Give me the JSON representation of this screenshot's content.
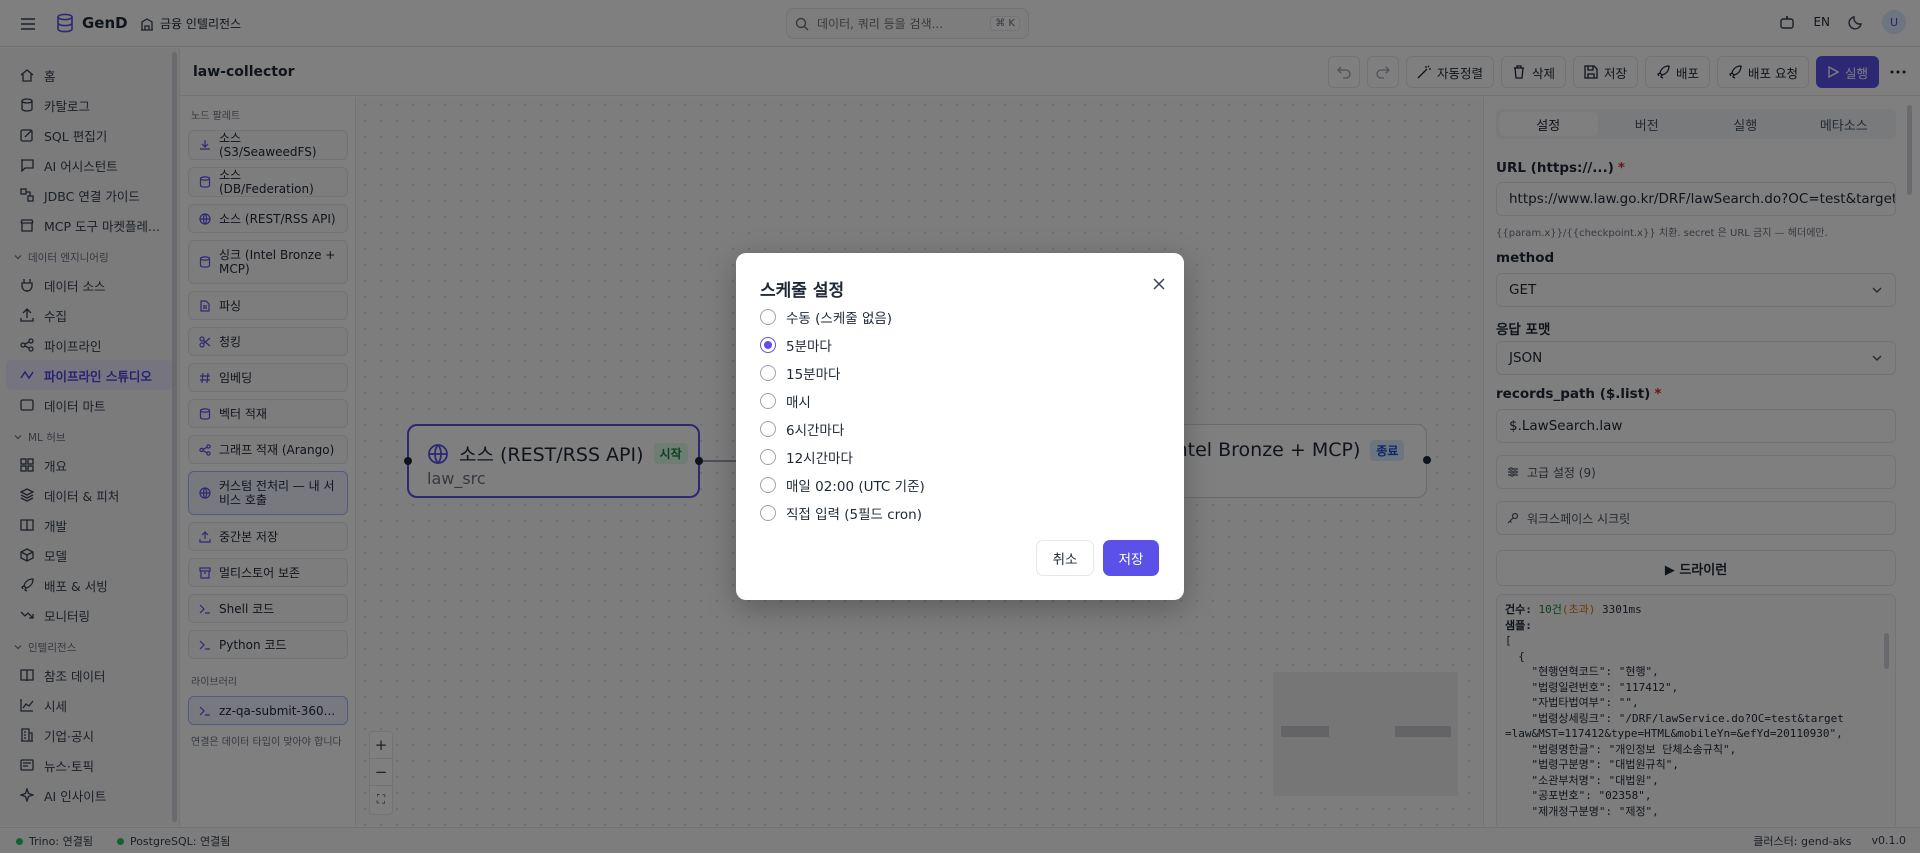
{
  "app": {
    "name": "GenD",
    "workspace": "금융 인텔리전스"
  },
  "search": {
    "placeholder": "데이터, 쿼리 등을 검색...",
    "shortcut": "⌘ K"
  },
  "topbar": {
    "language": "EN",
    "avatar_initial": "U"
  },
  "sidebar": {
    "items_top": [
      "홈",
      "카탈로그",
      "SQL 편집기",
      "AI 어시스턴트",
      "JDBC 연결 가이드",
      "MCP 도구 마켓플레..."
    ],
    "section_data_eng": "데이터 엔지니어링",
    "items_data_eng": [
      "데이터 소스",
      "수집",
      "파이프라인",
      "파이프라인 스튜디오",
      "데이터 마트"
    ],
    "section_ml": "ML 허브",
    "items_ml": [
      "개요",
      "데이터 & 피처",
      "개발",
      "모델",
      "배포 & 서빙",
      "모니터링"
    ],
    "section_intel": "인텔리전스",
    "items_intel": [
      "참조 데이터",
      "시세",
      "기업·공시",
      "뉴스·토픽",
      "AI 인사이트"
    ]
  },
  "pipeline": {
    "title": "law-collector"
  },
  "toolbar": {
    "auto_align": "자동정렬",
    "delete": "삭제",
    "save": "저장",
    "deploy": "배포",
    "deploy_request": "배포 요청",
    "run": "실행"
  },
  "palette": {
    "label": "노드 팔레트",
    "items": [
      "소스 (S3/SeaweedFS)",
      "소스 (DB/Federation)",
      "소스 (REST/RSS API)",
      "싱크 (Intel Bronze + MCP)",
      "파싱",
      "청킹",
      "임베딩",
      "벡터 적재",
      "그래프 적재 (Arango)",
      "커스텀 전처리 — 내 서비스 호출",
      "중간본 저장",
      "멀티스토어 보존",
      "Shell 코드",
      "Python 코드"
    ],
    "library_label": "라이브러리",
    "library_items": [
      "zz-qa-submit-360..."
    ],
    "footer": "연결은 데이터 타입이 맞아야 합니다"
  },
  "canvas": {
    "node1": {
      "title": "소스 (REST/RSS API)",
      "badge": "시작",
      "subtitle": "law_src"
    },
    "node2": {
      "title": "Intel Bronze + MCP)",
      "badge": "종료"
    },
    "zoom_in": "+",
    "zoom_out": "−",
    "fit": "⛶"
  },
  "panel": {
    "tabs": [
      "설정",
      "버전",
      "실행",
      "메타소스"
    ],
    "url_label": "URL (https://...)",
    "url_value": "https://www.law.go.kr/DRF/lawSearch.do?OC=test&target=",
    "url_hint": "{{param.x}}/{{checkpoint.x}} 치환. secret 은 URL 금지 — 헤더에만.",
    "method_label": "method",
    "method_value": "GET",
    "format_label": "응답 포맷",
    "format_value": "JSON",
    "records_label": "records_path ($.list)",
    "records_value": "$.LawSearch.law",
    "advanced": "고급 설정 (9)",
    "secrets": "워크스페이스 시크릿",
    "dry_run": "▶ 드라이런",
    "result_count_label": "건수:",
    "result_count": "10건",
    "result_over": "(초과)",
    "result_time": "3301ms",
    "sample_label": "샘플:",
    "sample_lines": [
      "[",
      "  {",
      "    \"현행연혁코드\": \"현행\",",
      "    \"법령일련번호\": \"117412\",",
      "    \"자법타법여부\": \"\",",
      "    \"법령상세링크\": \"/DRF/lawService.do?OC=test&target",
      "=law&MST=117412&type=HTML&mobileYn=&efYd=20110930\",",
      "    \"법령명한글\": \"개인정보 단체소송규칙\",",
      "    \"법령구분명\": \"대법원규칙\",",
      "    \"소관부처명\": \"대법원\",",
      "    \"공포번호\": \"02358\",",
      "    \"제개정구분명\": \"제정\","
    ]
  },
  "status": {
    "trino": "Trino: 연결됨",
    "postgres": "PostgreSQL: 연결됨",
    "cluster": "클러스터: gend-aks",
    "version": "v0.1.0"
  },
  "modal": {
    "title": "스케줄 설정",
    "options": [
      "수동 (스케줄 없음)",
      "5분마다",
      "15분마다",
      "매시",
      "6시간마다",
      "12시간마다",
      "매일 02:00 (UTC 기준)",
      "직접 입력 (5필드 cron)"
    ],
    "selected_index": 1,
    "cancel": "취소",
    "save": "저장"
  },
  "colors": {
    "accent": "#5b50e8",
    "start_badge": "#15803d",
    "end_badge": "#1d4ed8"
  }
}
